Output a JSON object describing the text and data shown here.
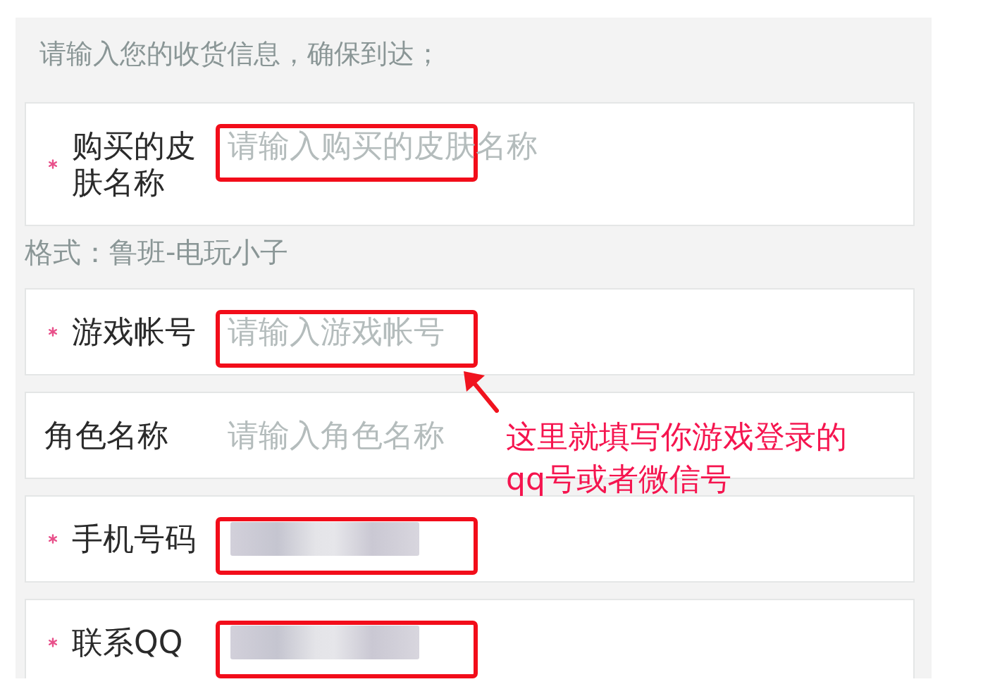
{
  "intro": "请输入您的收货信息，确保到达；",
  "fields": [
    {
      "label": "购买的皮肤名称",
      "required": true,
      "placeholder": "请输入购买的皮肤名称",
      "blurred": false,
      "highlighted": true,
      "hint": "格式：鲁班-电玩小子"
    },
    {
      "label": "游戏帐号",
      "required": true,
      "placeholder": "请输入游戏帐号",
      "blurred": false,
      "highlighted": true
    },
    {
      "label": "角色名称",
      "required": false,
      "placeholder": "请输入角色名称",
      "blurred": false,
      "highlighted": false
    },
    {
      "label": "手机号码",
      "required": true,
      "blurred": true,
      "highlighted": true
    },
    {
      "label": "联系QQ",
      "required": true,
      "blurred": true,
      "highlighted": true
    }
  ],
  "annotation": {
    "note": "这里就填写你游戏登录的qq号或者微信号"
  }
}
